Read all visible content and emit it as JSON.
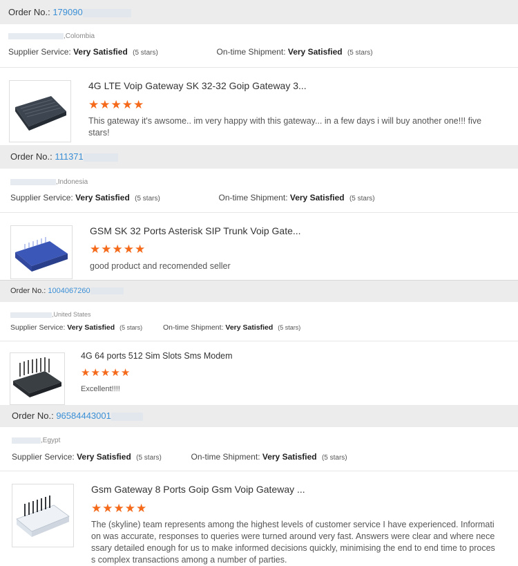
{
  "order_label": "Order No.:",
  "supplier_label": "Supplier Service:",
  "shipment_label": "On-time Shipment:",
  "reviews": [
    {
      "order_no": "179090",
      "country": ",Colombia",
      "supplier_value": "Very Satisfied",
      "supplier_stars": "(5 stars)",
      "shipment_value": "Very Satisfied",
      "shipment_stars": "(5 stars)",
      "product_title": "4G LTE Voip Gateway SK 32-32 Goip Gateway 3...",
      "rating": 5,
      "comment": "This gateway it's awsome.. im very happy with this gateway... in a few days i will buy another one!!! five stars!"
    },
    {
      "order_no": "111371",
      "country": ",Indonesia",
      "supplier_value": "Very Satisfied",
      "supplier_stars": "(5 stars)",
      "shipment_value": "Very Satisfied",
      "shipment_stars": "(5 stars)",
      "product_title": "GSM SK 32 Ports Asterisk SIP Trunk Voip Gate...",
      "rating": 5,
      "comment": "good product and recomended seller"
    },
    {
      "order_no": "1004067260",
      "country": ",United States",
      "supplier_value": "Very Satisfied",
      "supplier_stars": "(5 stars)",
      "shipment_value": "Very Satisfied",
      "shipment_stars": "(5 stars)",
      "product_title": "4G 64 ports 512 Sim Slots Sms Modem",
      "rating": 5,
      "comment": "Excellent!!!!"
    },
    {
      "order_no": "96584443001",
      "country": ",Egypt",
      "supplier_value": "Very Satisfied",
      "supplier_stars": "(5 stars)",
      "shipment_value": "Very Satisfied",
      "shipment_stars": "(5 stars)",
      "product_title": "Gsm Gateway 8 Ports Goip Gsm Voip Gateway ...",
      "rating": 5,
      "comment": "The (skyline) team represents among the highest levels of customer service I have experienced. Information was accurate, responses to queries were turned around very fast. Answers were clear and where necessary detailed enough for us to make informed decisions quickly, minimising the end to end time to process complex transactions among a number of parties."
    }
  ],
  "colors": {
    "link": "#3a8fd6",
    "star": "#f56a1a",
    "bar": "#ececec"
  },
  "icons": {
    "star": "star-icon"
  }
}
